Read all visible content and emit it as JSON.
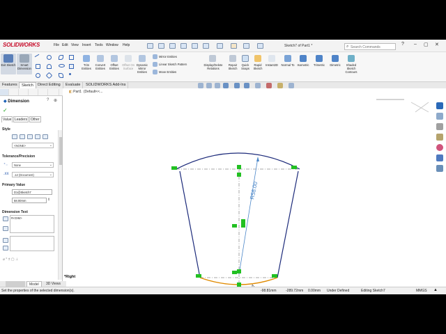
{
  "app": {
    "logo": "SOLIDWORKS",
    "document_title": "Sketch7 of Part1 *",
    "search_placeholder": "Search Commands"
  },
  "menu": [
    "File",
    "Edit",
    "View",
    "Insert",
    "Tools",
    "Window",
    "Help"
  ],
  "window_controls": [
    "?",
    "–",
    "▢",
    "✕"
  ],
  "ribbon": {
    "exit_sketch": "Exit Sketch",
    "smart_dimension": "Smart Dimension",
    "trim_entities": "Trim Entities",
    "convert_entities": "Convert Entities",
    "offset_entities": "Offset Entities",
    "offset_on_surface": "Offset On Surface",
    "dynamic_mirror": "Dynamic Mirror Entities",
    "mirror_entities": "Mirror Entities",
    "linear_pattern": "Linear Sketch Pattern",
    "move_entities": "Move Entities",
    "display_delete": "Display/Delete Relations",
    "repair_sketch": "Repair Sketch",
    "quick_snaps": "Quick Snaps",
    "rapid_sketch": "Rapid Sketch",
    "instant2d": "Instant2D",
    "normal_to": "Normal To",
    "isometric": "Isometric",
    "trimetric": "Trimetric",
    "dimetric": "Dimetric",
    "shaded_contours": "Shaded Sketch Contours"
  },
  "tabs": [
    "Features",
    "Sketch",
    "Direct Editing",
    "Evaluate",
    "SOLIDWORKS Add-Ins"
  ],
  "active_tab": "Sketch",
  "tree": {
    "part": "Part1",
    "config": "(Default<<..."
  },
  "property_manager": {
    "title": "Dimension",
    "subtabs": [
      "Value",
      "Leaders",
      "Other"
    ],
    "style_label": "Style",
    "style_value": "<NONE>",
    "tolerance_label": "Tolerance/Precision",
    "tolerance_value": "None",
    "precision_value": ".12 (Document)",
    "primary_value_label": "Primary Value",
    "dimension_name": "D1@Sketch7",
    "dimension_value": "58.00mm",
    "dimension_text_label": "Dimension Text",
    "dimension_text": "R<DIM>"
  },
  "dimension_label": "R58.00",
  "view_label": "*Right",
  "bottom_tabs": [
    "Model",
    "3D Views"
  ],
  "status": {
    "message": "Set the properties of the selected dimension(s).",
    "x": "-98.81mm",
    "y": "-289.72mm",
    "z": "0.00mm",
    "state": "Under Defined",
    "editing": "Editing Sketch7",
    "units": "MMGS"
  },
  "colors": {
    "arc": "#1c2a7a",
    "selected": "#e08a00",
    "dimension": "#4a86c8",
    "point": "#22c022",
    "brand": "#c8102e"
  }
}
